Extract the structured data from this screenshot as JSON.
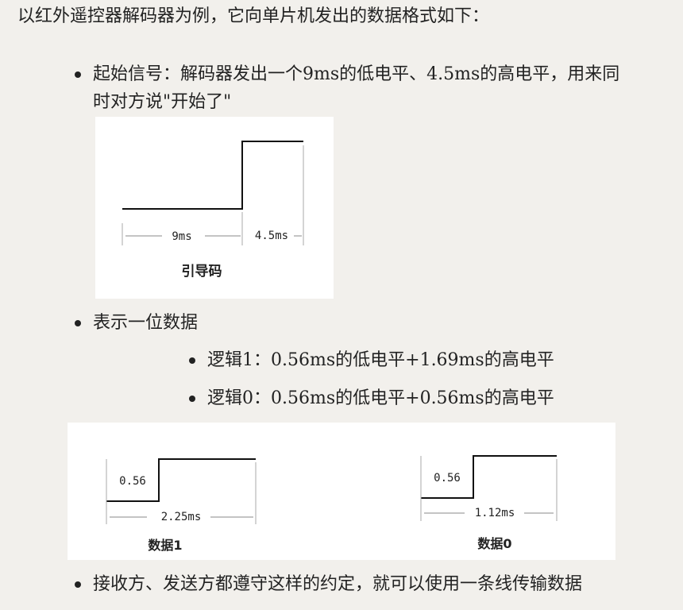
{
  "intro": "以红外遥控器解码器为例，它向单片机发出的数据格式如下：",
  "bullets": {
    "start_line1": "起始信号：解码器发出一个9ms的低电平、4.5ms的高电平，用来同",
    "start_line2": "时对方说\"开始了\"",
    "data_bit": "表示一位数据",
    "logic1": "逻辑1：0.56ms的低电平+1.69ms的高电平",
    "logic0": "逻辑0：0.56ms的低电平+0.56ms的高电平",
    "conclusion": "接收方、发送方都遵守这样的约定，就可以使用一条线传输数据"
  },
  "figure_leader": {
    "low_label": "9ms",
    "high_label": "4.5ms",
    "caption": "引导码"
  },
  "figure_bits": {
    "bit1": {
      "low_label": "0.56",
      "total_label": "2.25ms",
      "caption": "数据1"
    },
    "bit0": {
      "low_label": "0.56",
      "total_label": "1.12ms",
      "caption": "数据0"
    }
  }
}
